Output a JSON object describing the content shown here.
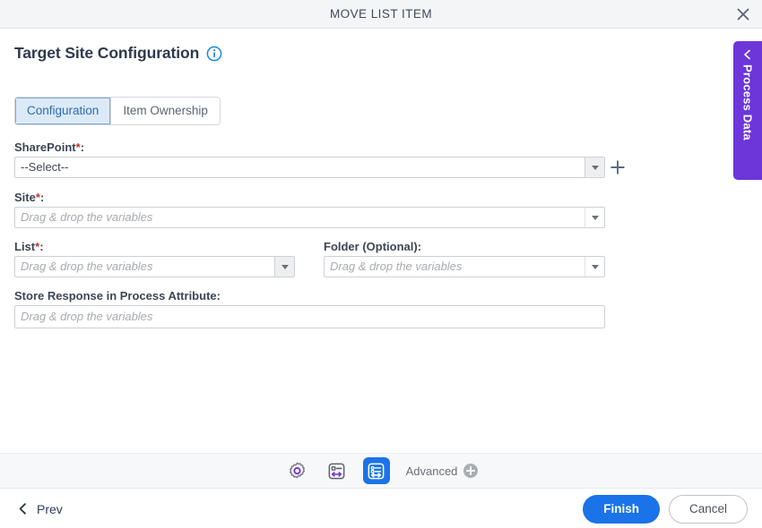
{
  "window": {
    "title": "MOVE LIST ITEM",
    "close_icon": "close-icon"
  },
  "page": {
    "heading": "Target Site Configuration",
    "info_icon": "info-icon"
  },
  "tabs": [
    {
      "label": "Configuration",
      "active": true
    },
    {
      "label": "Item Ownership",
      "active": false
    }
  ],
  "form": {
    "sharepoint": {
      "label": "SharePoint",
      "required_marker": "*",
      "suffix": ":",
      "value": "--Select--",
      "add_icon": "plus-icon"
    },
    "site": {
      "label": "Site",
      "required_marker": "*",
      "suffix": ":",
      "placeholder": "Drag & drop the variables"
    },
    "list": {
      "label": "List",
      "required_marker": "*",
      "suffix": ":",
      "placeholder": "Drag & drop the variables"
    },
    "folder": {
      "label": "Folder (Optional)",
      "required_marker": "",
      "suffix": ":",
      "placeholder": "Drag & drop the variables"
    },
    "store_response": {
      "label": "Store Response in Process Attribute",
      "required_marker": "",
      "suffix": ":",
      "placeholder": "Drag & drop the variables"
    }
  },
  "process_data_tab": {
    "label": "Process Data",
    "chevron_icon": "chevron-left-icon"
  },
  "toolbar": {
    "settings_icon": "gear-icon",
    "form_mapping_icon": "form-field-arrows-icon",
    "list_mapping_icon": "list-field-arrows-icon",
    "advanced_label": "Advanced",
    "advanced_add_icon": "circle-plus-icon"
  },
  "footer": {
    "prev_label": "Prev",
    "prev_icon": "chevron-left-icon",
    "finish_label": "Finish",
    "cancel_label": "Cancel"
  },
  "colors": {
    "accent_blue": "#1a73e8",
    "accent_purple": "#6c36d9",
    "required_red": "#c0392b",
    "tab_active_bg": "#dceaf8"
  }
}
